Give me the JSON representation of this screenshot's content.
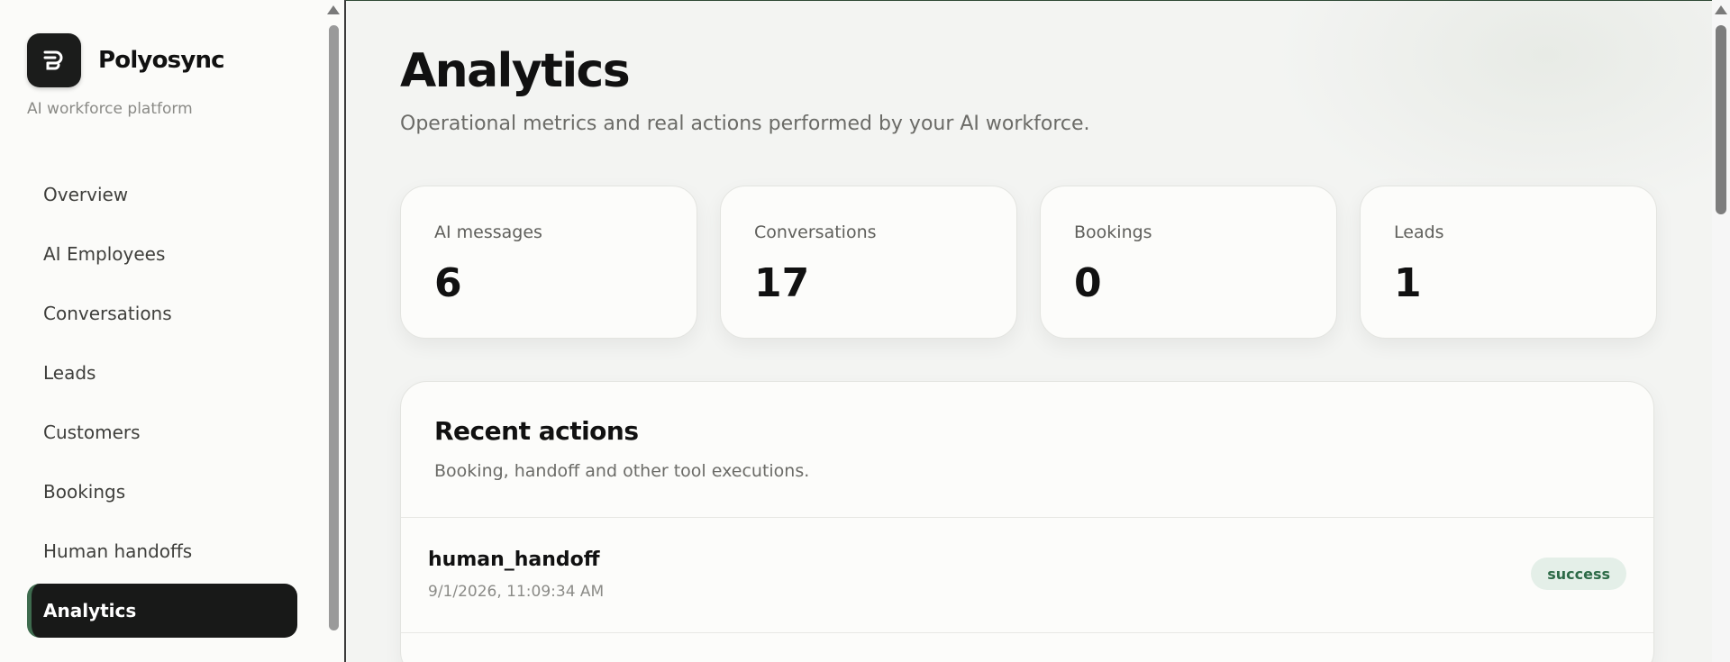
{
  "brand": {
    "name": "Polyosync",
    "tagline": "AI workforce platform"
  },
  "nav": {
    "items": [
      {
        "label": "Overview"
      },
      {
        "label": "AI Employees"
      },
      {
        "label": "Conversations"
      },
      {
        "label": "Leads"
      },
      {
        "label": "Customers"
      },
      {
        "label": "Bookings"
      },
      {
        "label": "Human handoffs"
      },
      {
        "label": "Analytics",
        "active": true
      }
    ]
  },
  "page": {
    "title": "Analytics",
    "subtitle": "Operational metrics and real actions performed by your AI workforce."
  },
  "stats": [
    {
      "label": "AI messages",
      "value": "6"
    },
    {
      "label": "Conversations",
      "value": "17"
    },
    {
      "label": "Bookings",
      "value": "0"
    },
    {
      "label": "Leads",
      "value": "1"
    }
  ],
  "recent_actions": {
    "title": "Recent actions",
    "subtitle": "Booking, handoff and other tool executions.",
    "items": [
      {
        "name": "human_handoff",
        "time": "9/1/2026, 11:09:34 AM",
        "status": "success"
      }
    ]
  },
  "colors": {
    "active_nav": "#181918",
    "accent": "#3e6b4e",
    "success_badge_bg": "#e4efe8",
    "success_badge_text": "#2e6b48"
  },
  "icons": {
    "logo": "polyosync-logo-icon"
  }
}
